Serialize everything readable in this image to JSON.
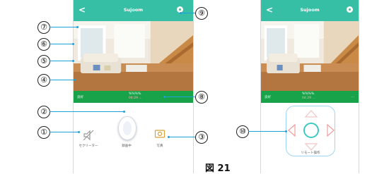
{
  "left_screen": {
    "back_glyph": "<",
    "title": "Sujoom",
    "status": {
      "left": "良好",
      "center_a": "%%%%.",
      "center_b": "04:29 ...",
      "right": "..."
    },
    "controls": {
      "left_label": "セクリーター",
      "center_label": "録画中",
      "right_label": "写真"
    }
  },
  "right_screen": {
    "back_glyph": "<",
    "title": "Sujoom",
    "status": {
      "left": "良好",
      "center_a": "%%%%.",
      "center_b": "04:29 ...",
      "right": "..."
    },
    "dpad_label": "リモート操作"
  },
  "callouts": [
    "①",
    "②",
    "③",
    "④",
    "⑤",
    "⑥",
    "⑦",
    "⑧",
    "⑨",
    "⑩"
  ],
  "figure_caption": "図 21",
  "colors": {
    "topbar": "#36bfa5",
    "statusbar": "#18a24a",
    "leader": "#1fa0d8"
  }
}
